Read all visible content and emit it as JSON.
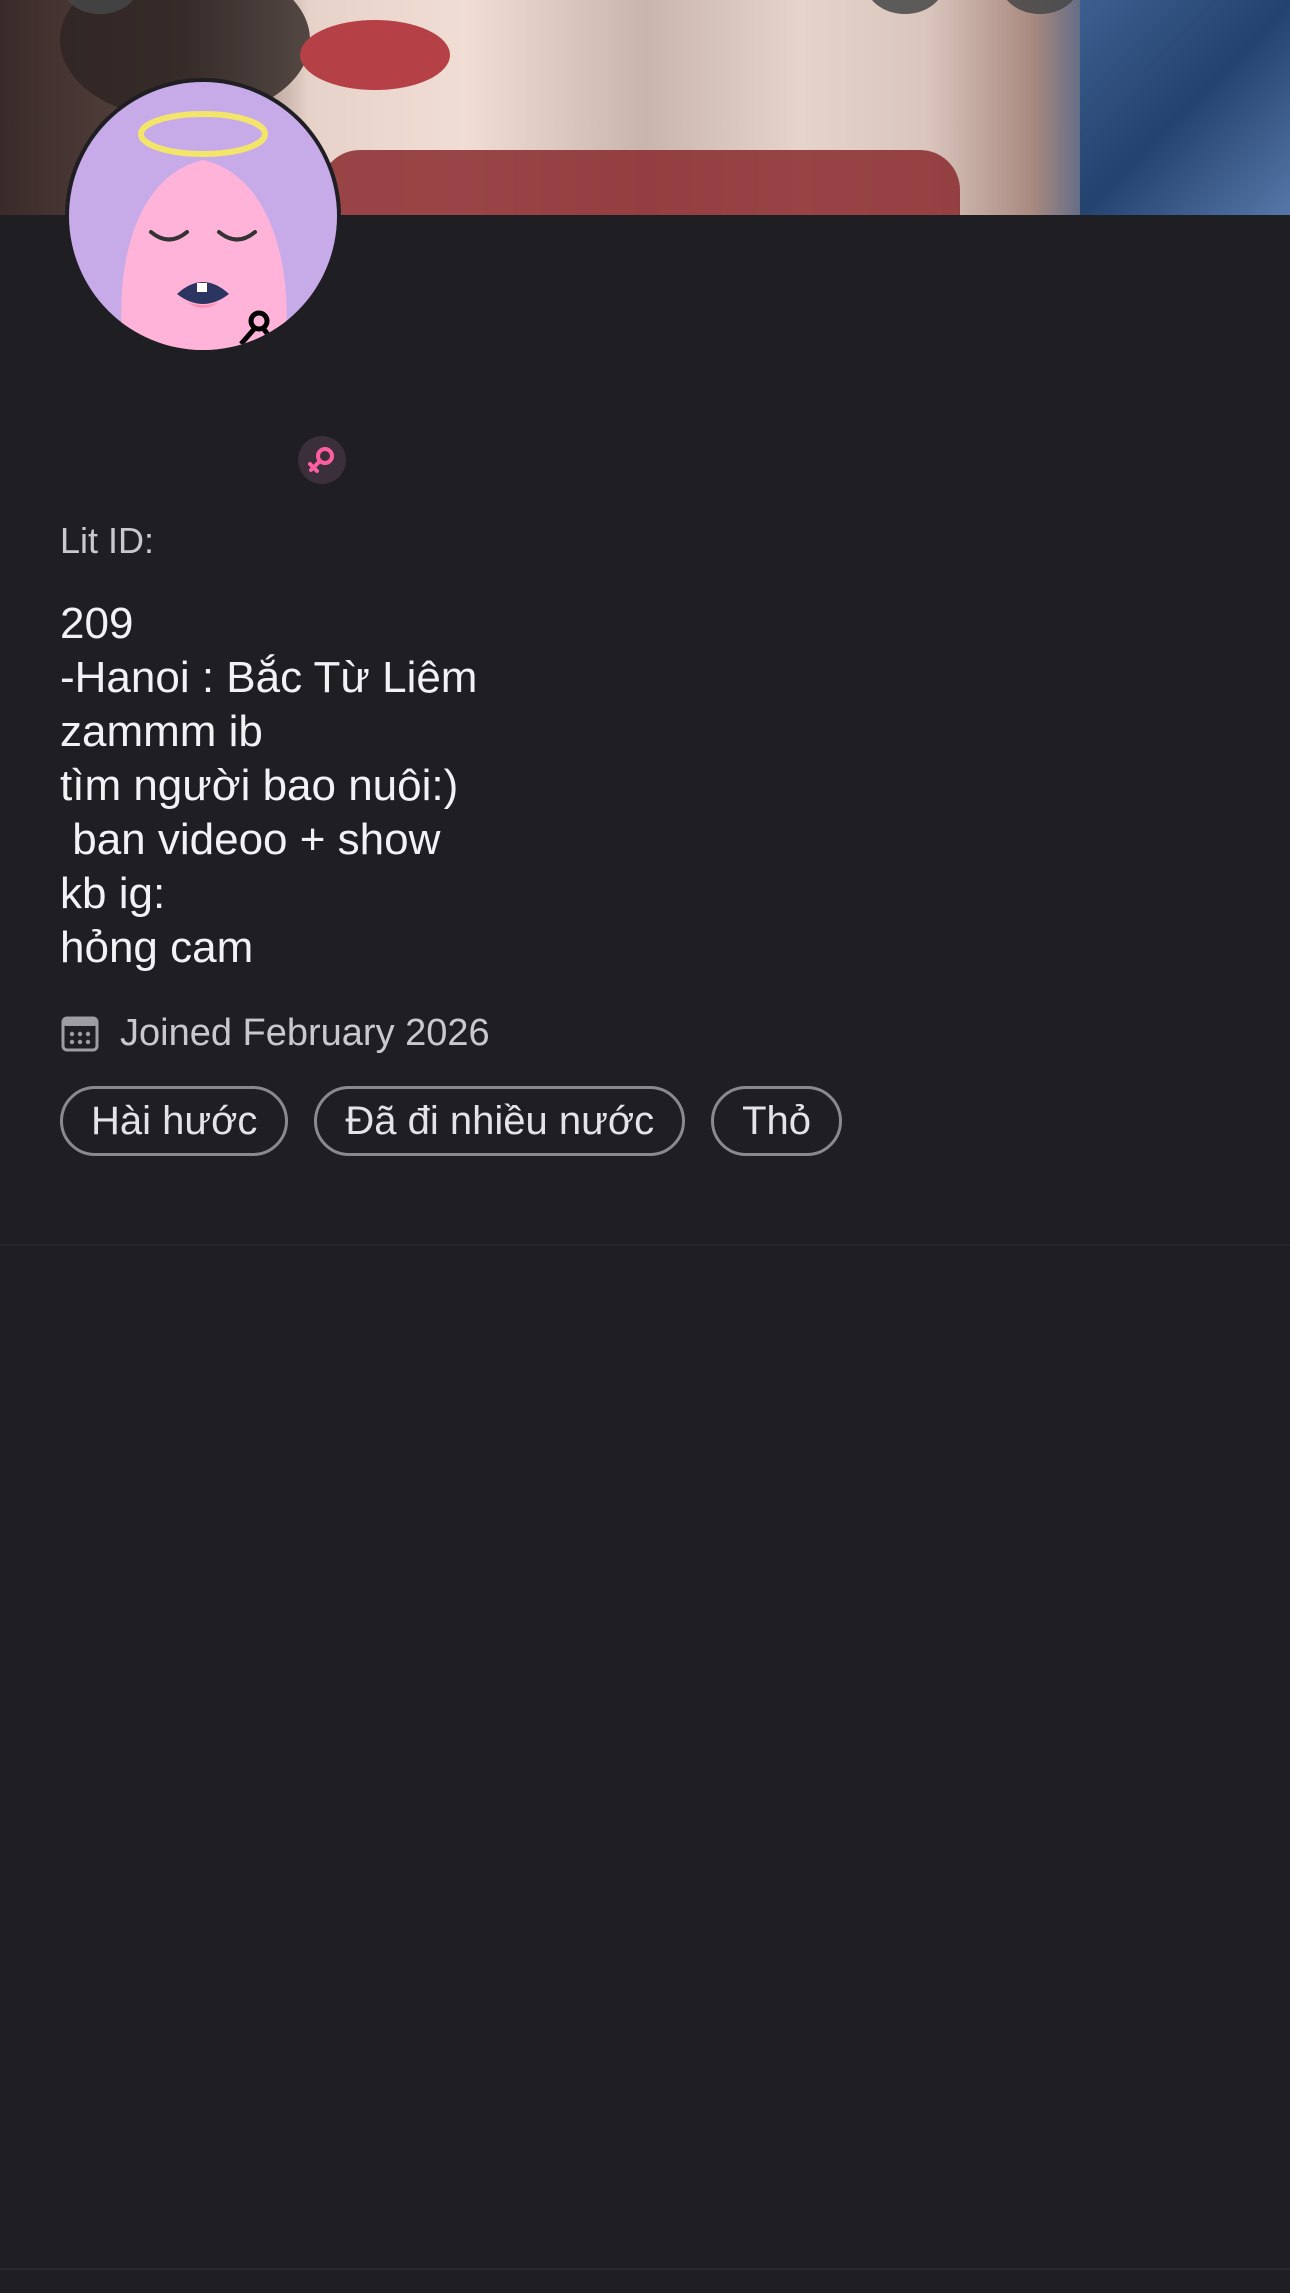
{
  "profile": {
    "lit_id_label": "Lit ID:",
    "bio_lines": [
      "209",
      "-Hanoi : Bắc Từ Liêm",
      "zammm ib",
      "tìm người bao nuôi:)",
      " ban videoo + show",
      "kb ig:",
      "hỏng cam"
    ],
    "joined_text": "Joined February 2026",
    "tags": [
      "Hài hước",
      "Đã đi nhiều nước",
      "Thỏ"
    ],
    "gender_icon": "female-icon",
    "avatar_icon": "angel-monster-avatar"
  },
  "colors": {
    "background": "#1f1e23",
    "accent_pink": "#ff5fa2",
    "avatar_bg": "#c7abe9"
  }
}
